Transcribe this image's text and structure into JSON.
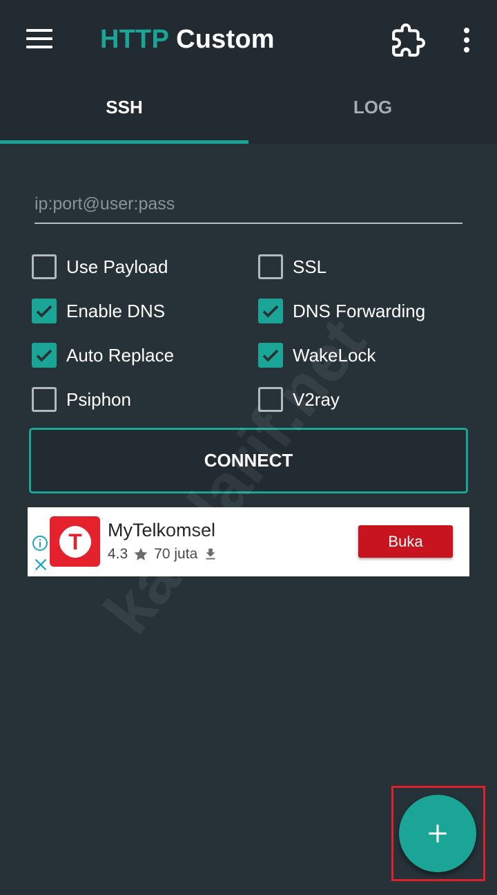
{
  "appbar": {
    "title_part1": "HTTP",
    "title_part2": "Custom",
    "icons": [
      "menu-icon",
      "extension-icon",
      "more-vert-icon"
    ]
  },
  "tabs": [
    {
      "label": "SSH",
      "selected": true
    },
    {
      "label": "LOG",
      "selected": false
    }
  ],
  "host": {
    "value": "",
    "placeholder": "ip:port@user:pass"
  },
  "options": [
    {
      "label": "Use Payload",
      "checked": false
    },
    {
      "label": "SSL",
      "checked": false
    },
    {
      "label": "Enable DNS",
      "checked": true
    },
    {
      "label": "DNS Forwarding",
      "checked": true
    },
    {
      "label": "Auto Replace",
      "checked": true
    },
    {
      "label": "WakeLock",
      "checked": true
    },
    {
      "label": "Psiphon",
      "checked": false
    },
    {
      "label": "V2ray",
      "checked": false
    }
  ],
  "connect_label": "CONNECT",
  "ad": {
    "app_name": "MyTelkomsel",
    "rating": "4.3",
    "installs": "70 juta",
    "button_label": "Buka",
    "logo_letter": "T"
  },
  "watermark": "kaddarif.net",
  "colors": {
    "background": "#263238",
    "appbar": "#212b31",
    "accent": "#1aa596",
    "ad_button": "#c8141f",
    "highlight": "#e0212b"
  }
}
